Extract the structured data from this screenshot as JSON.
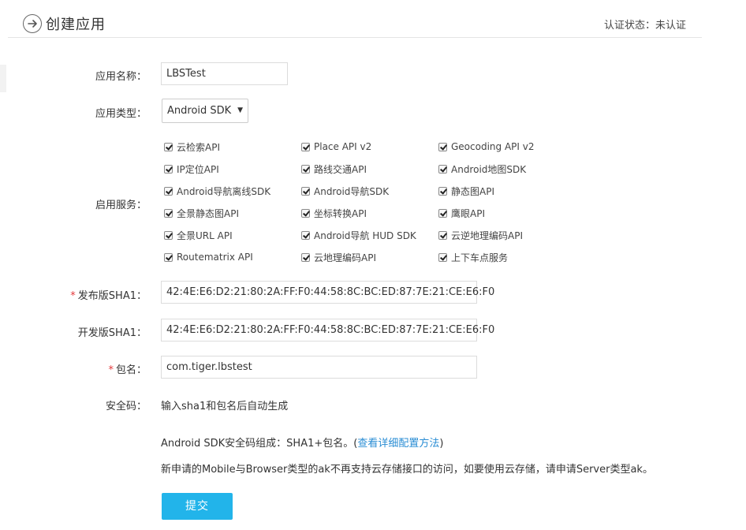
{
  "header": {
    "title": "创建应用",
    "auth_label": "认证状态：",
    "auth_value": "未认证"
  },
  "form": {
    "app_name": {
      "label": "应用名称：",
      "value": "LBSTest"
    },
    "app_type": {
      "label": "应用类型：",
      "value": "Android SDK"
    },
    "services": {
      "label": "启用服务：",
      "items": [
        {
          "label": "云检索API",
          "checked": true
        },
        {
          "label": "Place API v2",
          "checked": true
        },
        {
          "label": "Geocoding API v2",
          "checked": true
        },
        {
          "label": "IP定位API",
          "checked": true
        },
        {
          "label": "路线交通API",
          "checked": true
        },
        {
          "label": "Android地图SDK",
          "checked": true
        },
        {
          "label": "Android导航离线SDK",
          "checked": true
        },
        {
          "label": "Android导航SDK",
          "checked": true
        },
        {
          "label": "静态图API",
          "checked": true
        },
        {
          "label": "全景静态图API",
          "checked": true
        },
        {
          "label": "坐标转换API",
          "checked": true
        },
        {
          "label": "鹰眼API",
          "checked": true
        },
        {
          "label": "全景URL API",
          "checked": true
        },
        {
          "label": "Android导航 HUD SDK",
          "checked": true
        },
        {
          "label": "云逆地理编码API",
          "checked": true
        },
        {
          "label": "Routematrix API",
          "checked": true
        },
        {
          "label": "云地理编码API",
          "checked": true
        },
        {
          "label": "上下车点服务",
          "checked": true
        }
      ]
    },
    "release_sha1": {
      "required_mark": "*",
      "label": "发布版SHA1：",
      "value": "42:4E:E6:D2:21:80:2A:FF:F0:44:58:8C:BC:ED:87:7E:21:CE:E6:F0"
    },
    "dev_sha1": {
      "label": "开发版SHA1：",
      "value": "42:4E:E6:D2:21:80:2A:FF:F0:44:58:8C:BC:ED:87:7E:21:CE:E6:F0"
    },
    "package": {
      "required_mark": "*",
      "label": "包名：",
      "value": "com.tiger.lbstest"
    },
    "security_code": {
      "label": "安全码：",
      "value": "输入sha1和包名后自动生成"
    },
    "note_1_prefix": "Android SDK安全码组成：SHA1+包名。(",
    "note_1_link": "查看详细配置方法",
    "note_1_suffix": ")",
    "note_2": "新申请的Mobile与Browser类型的ak不再支持云存储接口的访问，如要使用云存储，请申请Server类型ak。",
    "submit_label": "提交"
  }
}
